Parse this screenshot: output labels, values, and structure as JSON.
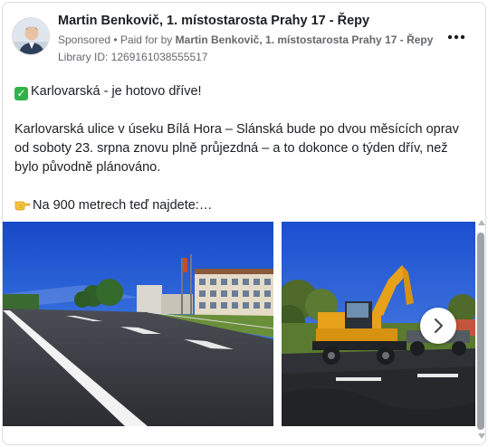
{
  "post": {
    "author": "Martin Benkovič, 1. místostarosta Prahy 17 - Řepy",
    "sponsored_label": "Sponsored",
    "separator": "•",
    "paid_for_prefix": "Paid for by",
    "paid_for_by": "Martin Benkovič, 1. místostarosta Prahy 17 - Řepy",
    "library_id": "Library ID: 1269161038555517",
    "more_icon": "more-options-icon"
  },
  "body": {
    "headline": "Karlovarská - je hotovo dříve!",
    "headline_icon": "check-mark-icon",
    "paragraph": "Karlovarská ulice v úseku Bílá Hora – Slánská bude po dvou měsících oprav od soboty 23. srpna znovu plně průjezdná – a to dokonce o týden dřív, než bylo původně plánováno.",
    "teaser": "Na 900 metrech teď najdete:…",
    "teaser_icon": "pointing-hand-icon"
  },
  "carousel": {
    "images": [
      "road-photo",
      "excavator-photo"
    ],
    "next_icon": "chevron-right-icon"
  },
  "colors": {
    "check_green": "#30b34b",
    "meta_gray": "#65676b",
    "border": "#dadde1"
  }
}
